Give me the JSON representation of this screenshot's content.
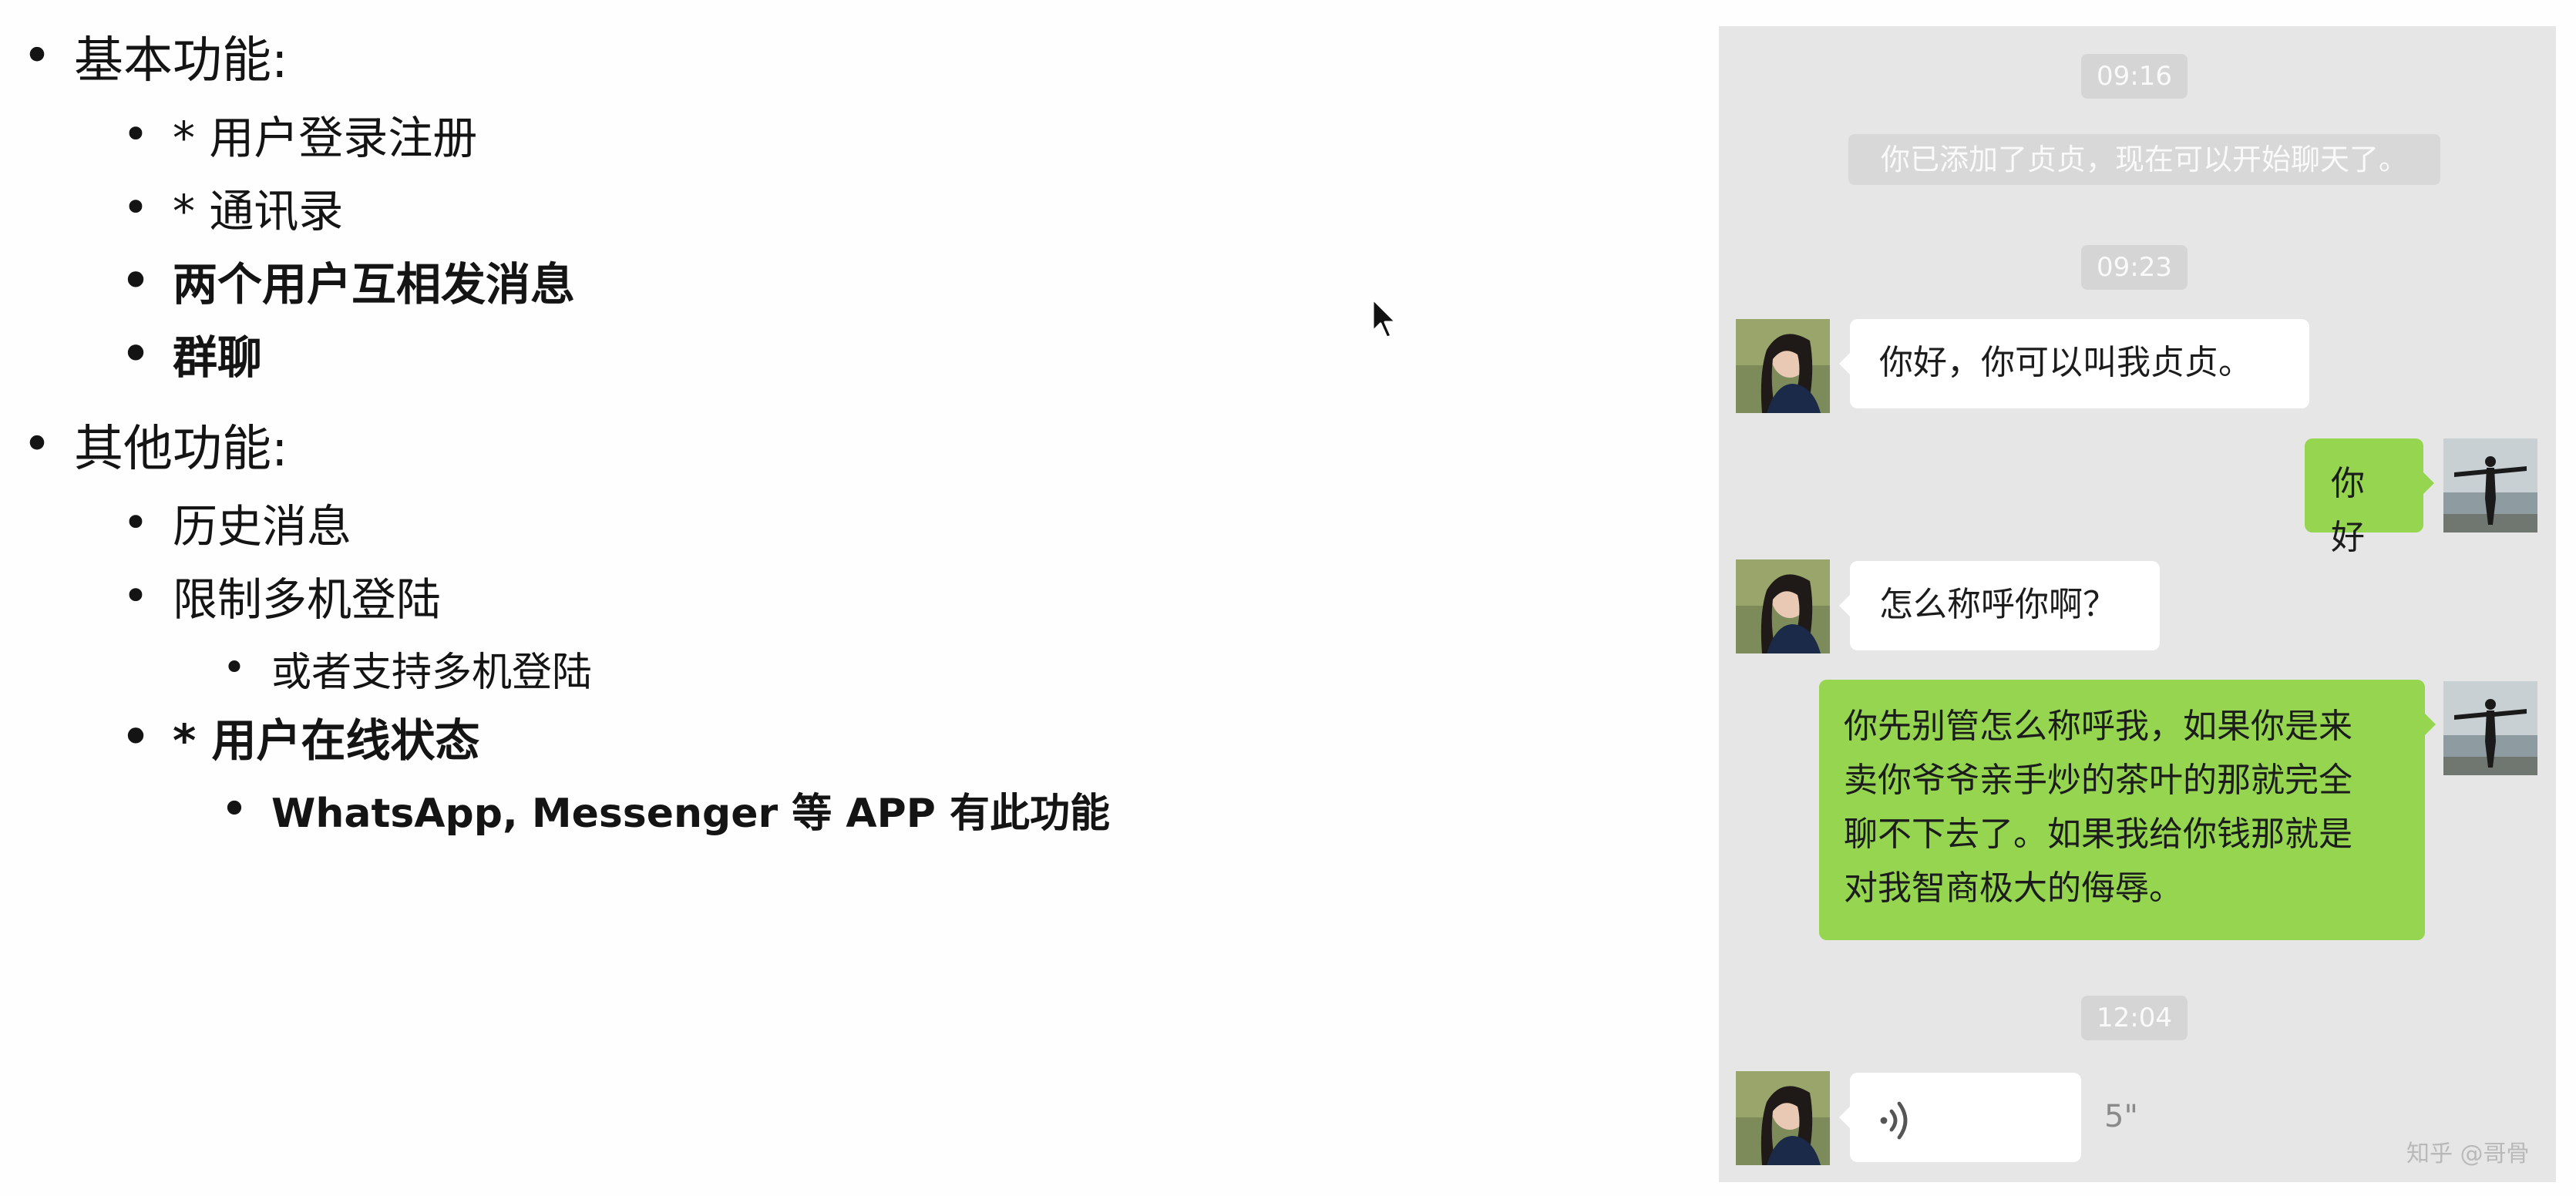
{
  "outline": {
    "basic_heading": "基本功能:",
    "basic_items": [
      "* 用户登录注册",
      "* 通讯录",
      "两个用户互相发消息",
      "群聊"
    ],
    "other_heading": "其他功能:",
    "other_items": [
      "历史消息",
      "限制多机登陆",
      "* 用户在线状态"
    ],
    "other_subitems": [
      "或者支持多机登陆",
      "WhatsApp, Messenger 等 APP 有此功能"
    ]
  },
  "chat": {
    "timestamps": [
      "09:16",
      "09:23",
      "12:04"
    ],
    "system_message": "你已添加了贞贞，现在可以开始聊天了。",
    "messages": [
      {
        "from": "other",
        "text": "你好，你可以叫我贞贞。"
      },
      {
        "from": "me",
        "text": "你好"
      },
      {
        "from": "other",
        "text": "怎么称呼你啊？"
      },
      {
        "from": "me",
        "text": "你先别管怎么称呼我，如果你是来\n卖你爷爷亲手炒的茶叶的那就完全\n聊不下去了。如果我给你钱那就是\n对我智商极大的侮辱。"
      }
    ],
    "voice_message": {
      "icon": "voice-wave-icon",
      "duration": "5\""
    },
    "watermark": "知乎 @哥骨"
  },
  "colors": {
    "chat_bg": "#e6e6e6",
    "outgoing_bubble": "#95d54f",
    "incoming_bubble": "#ffffff"
  }
}
